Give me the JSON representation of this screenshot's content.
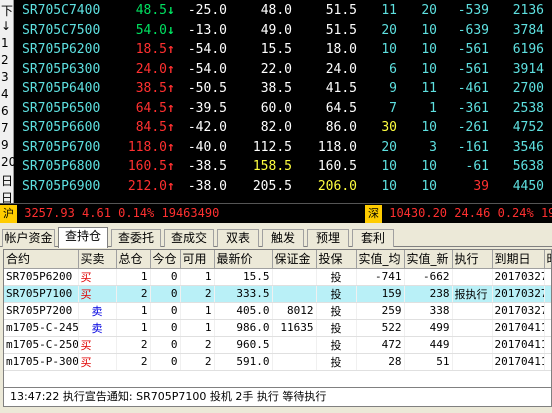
{
  "left_strip": [
    "下",
    "↓",
    "1",
    "2",
    "3",
    "4",
    "6",
    "7",
    "9",
    "20",
    "日",
    "日"
  ],
  "quotes": [
    {
      "name": "SR705C7400",
      "last": "48.5",
      "arrow": "↓",
      "dir": "down",
      "change": "-25.0",
      "bid": "48.0",
      "ask": "51.5",
      "bid_vol": "11",
      "ask_vol": "20",
      "oi_change": "-539",
      "volume": "2136"
    },
    {
      "name": "SR705C7500",
      "last": "54.0",
      "arrow": "↓",
      "dir": "down",
      "change": "-13.0",
      "bid": "49.0",
      "ask": "51.5",
      "bid_vol": "20",
      "ask_vol": "10",
      "oi_change": "-639",
      "volume": "3784"
    },
    {
      "name": "SR705P6200",
      "last": "18.5",
      "arrow": "↑",
      "dir": "up",
      "change": "-54.0",
      "bid": "15.5",
      "ask": "18.0",
      "bid_vol": "10",
      "ask_vol": "10",
      "oi_change": "-561",
      "volume": "6196"
    },
    {
      "name": "SR705P6300",
      "last": "24.0",
      "arrow": "↑",
      "dir": "up",
      "change": "-54.0",
      "bid": "22.0",
      "ask": "24.0",
      "bid_vol": "6",
      "ask_vol": "10",
      "oi_change": "-561",
      "volume": "3914"
    },
    {
      "name": "SR705P6400",
      "last": "38.5",
      "arrow": "↑",
      "dir": "up",
      "change": "-50.5",
      "bid": "38.5",
      "ask": "41.5",
      "bid_vol": "9",
      "ask_vol": "11",
      "oi_change": "-461",
      "volume": "2700"
    },
    {
      "name": "SR705P6500",
      "last": "64.5",
      "arrow": "↑",
      "dir": "up",
      "change": "-39.5",
      "bid": "60.0",
      "ask": "64.5",
      "bid_vol": "7",
      "ask_vol": "1",
      "oi_change": "-361",
      "volume": "2538"
    },
    {
      "name": "SR705P6600",
      "last": "84.5",
      "arrow": "↑",
      "dir": "up",
      "change": "-42.0",
      "bid": "82.0",
      "ask": "86.0",
      "bid_vol": "30",
      "ask_vol": "10",
      "oi_change": "-261",
      "volume": "4752"
    },
    {
      "name": "SR705P6700",
      "last": "118.0",
      "arrow": "↑",
      "dir": "up",
      "change": "-40.0",
      "bid": "112.5",
      "ask": "118.0",
      "bid_vol": "20",
      "ask_vol": "3",
      "oi_change": "-161",
      "volume": "3546"
    },
    {
      "name": "SR705P6800",
      "last": "160.5",
      "arrow": "↑",
      "dir": "up",
      "change": "-38.5",
      "bid": "158.5",
      "ask": "160.5",
      "bid_vol": "10",
      "ask_vol": "10",
      "oi_change": "-61",
      "volume": "5638"
    },
    {
      "name": "SR705P6900",
      "last": "212.0",
      "arrow": "↑",
      "dir": "up",
      "change": "-38.0",
      "bid": "205.5",
      "ask": "206.0",
      "bid_vol": "10",
      "ask_vol": "10",
      "oi_change": "39",
      "volume": "4450"
    }
  ],
  "index_bar": {
    "sh_tag": "沪",
    "sh_text": "3257.93 4.61 0.14% 19463490",
    "sz_tag": "深",
    "sz_text": "10430.20 24.46 0.24% 19493"
  },
  "tabs": [
    "帐户资金",
    "查持仓",
    "查委托",
    "查成交",
    "双表",
    "触发",
    "预埋",
    "套利"
  ],
  "active_tab": "查持仓",
  "positions": {
    "columns": [
      "合约",
      "买卖",
      "总仓",
      "今仓",
      "可用",
      "最新价",
      "保证金",
      "投保",
      "实值_均",
      "实值_新",
      "执行",
      "到期日",
      "时"
    ],
    "rows": [
      {
        "contract": "SR705P6200",
        "side": "买",
        "total": "1",
        "today": "0",
        "avail": "1",
        "last": "15.5",
        "margin": "",
        "hedge": "投",
        "itm_avg": "-741",
        "itm_new": "-662",
        "exercise": "",
        "expiry": "20170327"
      },
      {
        "contract": "SR705P7100",
        "side": "买",
        "total": "2",
        "today": "0",
        "avail": "2",
        "last": "333.5",
        "margin": "",
        "hedge": "投",
        "itm_avg": "159",
        "itm_new": "238",
        "exercise": "报执行",
        "expiry": "20170327"
      },
      {
        "contract": "SR705P7200",
        "side": "卖",
        "total": "1",
        "today": "0",
        "avail": "1",
        "last": "405.0",
        "margin": "8012",
        "hedge": "投",
        "itm_avg": "259",
        "itm_new": "338",
        "exercise": "",
        "expiry": "20170327"
      },
      {
        "contract": "m1705-C-2450",
        "side": "卖",
        "total": "1",
        "today": "0",
        "avail": "1",
        "last": "986.0",
        "margin": "11635",
        "hedge": "投",
        "itm_avg": "522",
        "itm_new": "499",
        "exercise": "",
        "expiry": "20170411"
      },
      {
        "contract": "m1705-C-2500",
        "side": "买",
        "total": "2",
        "today": "0",
        "avail": "2",
        "last": "960.5",
        "margin": "",
        "hedge": "投",
        "itm_avg": "472",
        "itm_new": "449",
        "exercise": "",
        "expiry": "20170411"
      },
      {
        "contract": "m1705-P-3000",
        "side": "买",
        "total": "2",
        "today": "0",
        "avail": "2",
        "last": "591.0",
        "margin": "",
        "hedge": "投",
        "itm_avg": "28",
        "itm_new": "51",
        "exercise": "",
        "expiry": "20170411"
      }
    ]
  },
  "status": "13:47:22 执行宣告通知: SR705P7100 投机 2手 执行 等待执行",
  "colors": {
    "up": "#ff3030",
    "down": "#00e060",
    "cyan": "#5ee0e0",
    "yellow": "#ffff40",
    "selected_row": "#b9f0f7"
  }
}
